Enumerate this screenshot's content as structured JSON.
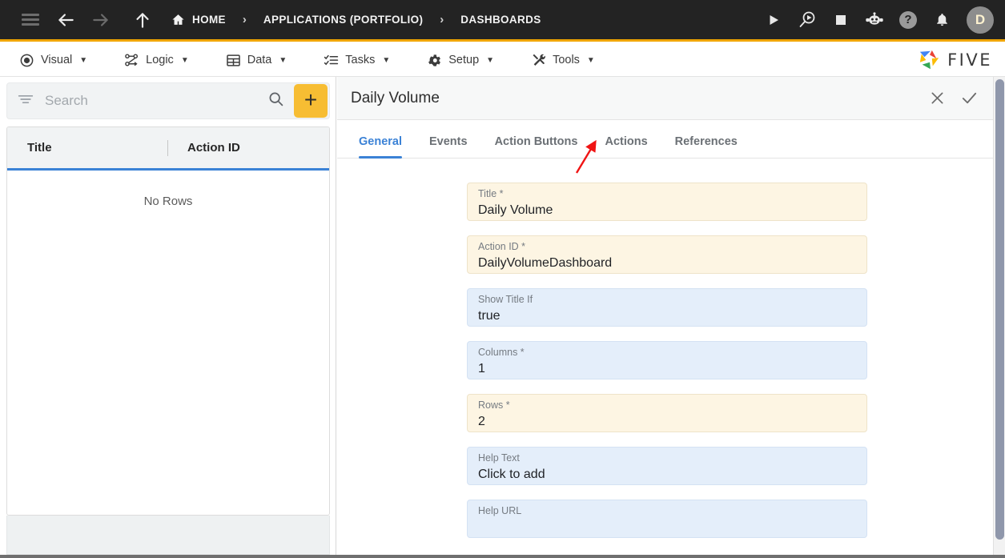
{
  "topbar": {
    "menu_icon": "hamburger-icon",
    "back_icon": "arrow-left-icon",
    "forward_icon": "arrow-right-icon",
    "up_icon": "arrow-up-icon",
    "breadcrumbs": [
      {
        "label": "HOME",
        "icon": "home-icon"
      },
      {
        "label": "APPLICATIONS (PORTFOLIO)"
      },
      {
        "label": "DASHBOARDS"
      }
    ],
    "separator": "›",
    "actions": [
      {
        "name": "run-button",
        "icon": "play-icon"
      },
      {
        "name": "debug-button",
        "icon": "magnifier-play-icon"
      },
      {
        "name": "stop-button",
        "icon": "stop-square-icon"
      },
      {
        "name": "assistant-button",
        "icon": "robot-icon"
      },
      {
        "name": "help-button",
        "icon": "question-circle-icon"
      },
      {
        "name": "notifications-button",
        "icon": "bell-icon"
      }
    ],
    "avatar_initial": "D",
    "accent_bar_color": "#f0a500",
    "background_color": "#232323"
  },
  "menubar": {
    "items": [
      {
        "label": "Visual",
        "icon": "eye-icon"
      },
      {
        "label": "Logic",
        "icon": "nodes-icon"
      },
      {
        "label": "Data",
        "icon": "table-icon"
      },
      {
        "label": "Tasks",
        "icon": "checklist-icon"
      },
      {
        "label": "Setup",
        "icon": "gear-icon"
      },
      {
        "label": "Tools",
        "icon": "tools-icon"
      }
    ],
    "caret": "▼",
    "brand": "FIVE"
  },
  "left_panel": {
    "search": {
      "placeholder": "Search",
      "value": "",
      "filter_icon": "filter-icon",
      "search_icon": "search-icon"
    },
    "add_button": {
      "label": "+",
      "icon": "plus-icon",
      "color": "#f7bd33"
    },
    "columns": [
      "Title",
      "Action ID"
    ],
    "empty_message": "No Rows",
    "rows": []
  },
  "detail": {
    "title": "Daily Volume",
    "close_icon": "close-icon",
    "confirm_icon": "check-icon",
    "tabs": [
      {
        "label": "General",
        "active": true
      },
      {
        "label": "Events",
        "active": false
      },
      {
        "label": "Action Buttons",
        "active": false
      },
      {
        "label": "Actions",
        "active": false
      },
      {
        "label": "References",
        "active": false
      }
    ],
    "active_tab_color": "#3b82d6",
    "fields": [
      {
        "label": "Title *",
        "value": "Daily Volume",
        "style": "cream"
      },
      {
        "label": "Action ID *",
        "value": "DailyVolumeDashboard",
        "style": "cream"
      },
      {
        "label": "Show Title If",
        "value": "true",
        "style": "blue"
      },
      {
        "label": "Columns *",
        "value": "1",
        "style": "blue"
      },
      {
        "label": "Rows *",
        "value": "2",
        "style": "cream"
      },
      {
        "label": "Help Text",
        "value": "Click to add",
        "style": "blue"
      },
      {
        "label": "Help URL",
        "value": "",
        "style": "blue"
      }
    ]
  },
  "annotation": {
    "type": "arrow",
    "color": "#f01414",
    "points_to": "Actions"
  }
}
